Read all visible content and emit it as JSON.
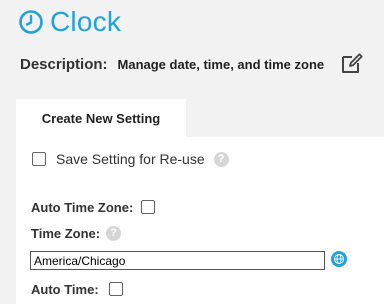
{
  "header": {
    "title": "Clock",
    "icon": "clock-icon",
    "accent_color": "#1fa3d8"
  },
  "description": {
    "label": "Description:",
    "value": "Manage date, time, and time zone",
    "edit_icon": "edit-icon"
  },
  "tabs": [
    {
      "label": "Create New Setting",
      "active": true
    }
  ],
  "form": {
    "save_setting": {
      "label": "Save Setting for Re-use",
      "checked": false,
      "help_icon": "help-icon"
    },
    "auto_time_zone": {
      "label": "Auto Time Zone:",
      "checked": false
    },
    "time_zone": {
      "label": "Time Zone:",
      "value": "America/Chicago",
      "help_icon": "help-icon",
      "picker_icon": "globe-icon"
    },
    "auto_time": {
      "label": "Auto Time:",
      "checked": false
    }
  }
}
